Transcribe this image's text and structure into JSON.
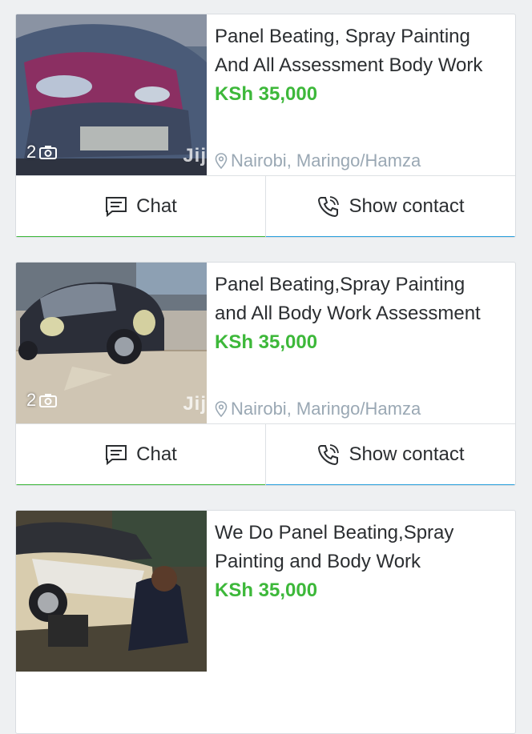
{
  "colors": {
    "price": "#3db83a",
    "chat_accent": "#3db83a",
    "contact_accent": "#2aa1dd",
    "location": "#9aa8b4"
  },
  "listings": [
    {
      "title_line1": "Panel Beating, Spray Painting",
      "title_line2": "And All Assessment Body Work",
      "price": "KSh 35,000",
      "location": "Nairobi, Maringo/Hamza",
      "photo_count": "2",
      "watermark": "Jij",
      "chat_label": "Chat",
      "contact_label": "Show contact"
    },
    {
      "title_line1": "Panel Beating,Spray Painting",
      "title_line2": "and All Body Work Assessment",
      "price": "KSh 35,000",
      "location": "Nairobi, Maringo/Hamza",
      "photo_count": "2",
      "watermark": "Jij",
      "chat_label": "Chat",
      "contact_label": "Show contact"
    },
    {
      "title_line1": "We Do Panel Beating,Spray",
      "title_line2": "Painting and Body Work",
      "price": "KSh 35,000",
      "location": "",
      "photo_count": "",
      "watermark": "",
      "chat_label": "",
      "contact_label": ""
    }
  ]
}
